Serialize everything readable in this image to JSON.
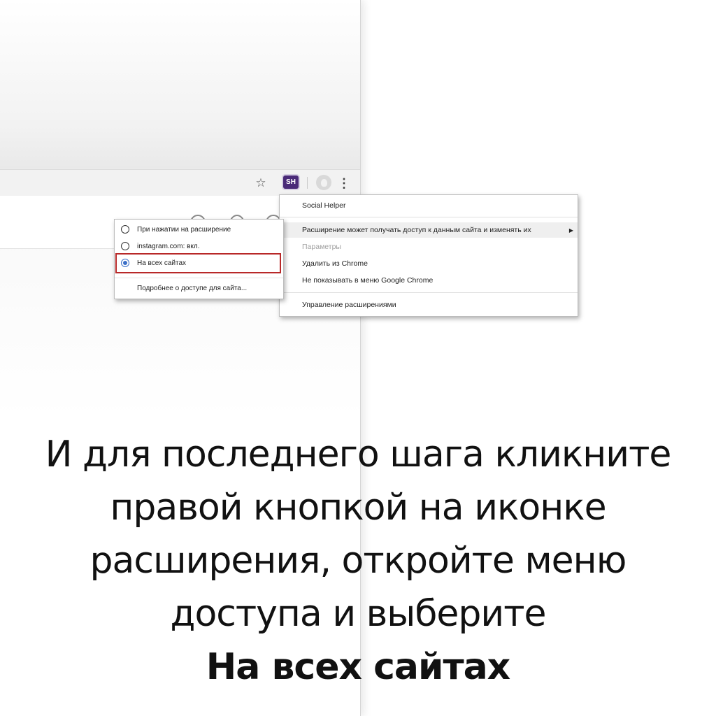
{
  "toolbar": {
    "extension_badge": "SH",
    "menu_dots": "⋮",
    "star": "☆"
  },
  "context_menu": {
    "title": "Social Helper",
    "items": [
      {
        "label": "Расширение может получать доступ к данным сайта и изменять их",
        "has_submenu": true,
        "highlighted": true
      },
      {
        "label": "Параметры",
        "disabled": true
      },
      {
        "label": "Удалить из Chrome"
      },
      {
        "label": "Не показывать в меню Google Chrome"
      }
    ],
    "footer": "Управление расширениями"
  },
  "access_submenu": {
    "options": [
      {
        "label": "При нажатии на расширение",
        "checked": false
      },
      {
        "label": "instagram.com: вкл.",
        "checked": false
      },
      {
        "label": "На всех сайтах",
        "checked": true
      }
    ],
    "more_link": "Подробнее о доступе для сайта..."
  },
  "caption": {
    "lines": [
      "И для последнего шага кликните",
      "правой кнопкой на иконке",
      "расширения, откройте меню",
      "доступа и выберите"
    ],
    "bold_line": "На всех сайтах"
  },
  "colors": {
    "selection_outline": "#b82828",
    "radio_checked": "#3b6fc7",
    "extension_badge_bg": "#4a2a78"
  }
}
